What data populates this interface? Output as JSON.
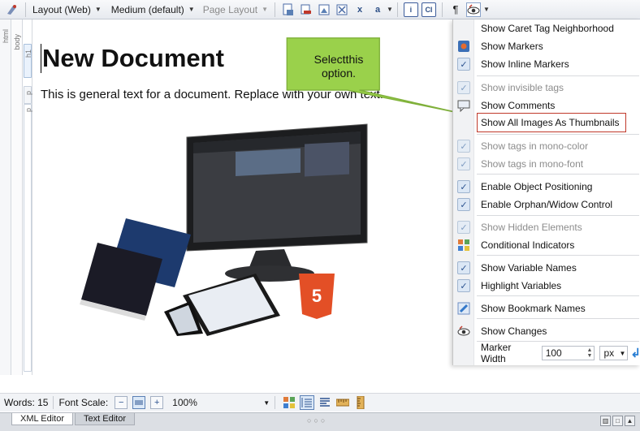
{
  "toolbar": {
    "layout_label": "Layout (Web)",
    "medium_label": "Medium (default)",
    "page_layout_label": "Page Layout",
    "pilcrow": "¶",
    "icon_a": "a",
    "icon_x": "x",
    "icon_i": "i",
    "icon_ci": "CI"
  },
  "structure": {
    "html_label": "html",
    "body_label": "body",
    "h1_label": "h1",
    "p1_label": "p",
    "p2_label": "p"
  },
  "document": {
    "title": "New Document",
    "body_text": "This is general text for a document. Replace with your own text.",
    "image_badge": "HTML 5"
  },
  "callout": {
    "text": "Selectthis option."
  },
  "menu": {
    "items": [
      {
        "label": "Show Caret Tag Neighborhood",
        "icon": "none",
        "disabled": false
      },
      {
        "label": "Show Markers",
        "icon": "markers-icon",
        "disabled": false
      },
      {
        "label": "Show Inline Markers",
        "icon": "check",
        "disabled": false
      },
      {
        "label": "Show invisible tags",
        "icon": "check",
        "disabled": true
      },
      {
        "label": "Show Comments",
        "icon": "comment-icon",
        "disabled": false
      },
      {
        "label": "Show All Images As Thumbnails",
        "icon": "none",
        "disabled": false
      },
      {
        "label": "Show tags in mono-color",
        "icon": "check",
        "disabled": true
      },
      {
        "label": "Show tags in mono-font",
        "icon": "check",
        "disabled": true
      },
      {
        "label": "Enable Object Positioning",
        "icon": "check",
        "disabled": false
      },
      {
        "label": "Enable Orphan/Widow Control",
        "icon": "check",
        "disabled": false
      },
      {
        "label": "Show Hidden Elements",
        "icon": "check",
        "disabled": true
      },
      {
        "label": "Conditional Indicators",
        "icon": "conditional-icon",
        "disabled": false
      },
      {
        "label": "Show Variable Names",
        "icon": "check",
        "disabled": false
      },
      {
        "label": "Highlight Variables",
        "icon": "check",
        "disabled": false
      },
      {
        "label": "Show Bookmark Names",
        "icon": "bookmark-icon",
        "disabled": false
      },
      {
        "label": "Show Changes",
        "icon": "changes-icon",
        "disabled": false
      }
    ],
    "marker_width_label": "Marker Width",
    "marker_width_value": "100",
    "marker_width_unit": "px"
  },
  "status": {
    "words_label": "Words: 15",
    "font_scale_label": "Font Scale:",
    "zoom_value": "100%"
  },
  "tabs": {
    "xml_editor": "XML Editor",
    "text_editor": "Text Editor"
  },
  "colors": {
    "highlight_border": "#c0392b",
    "callout_fill": "#9ad14b",
    "check_blue": "#2c5390"
  }
}
